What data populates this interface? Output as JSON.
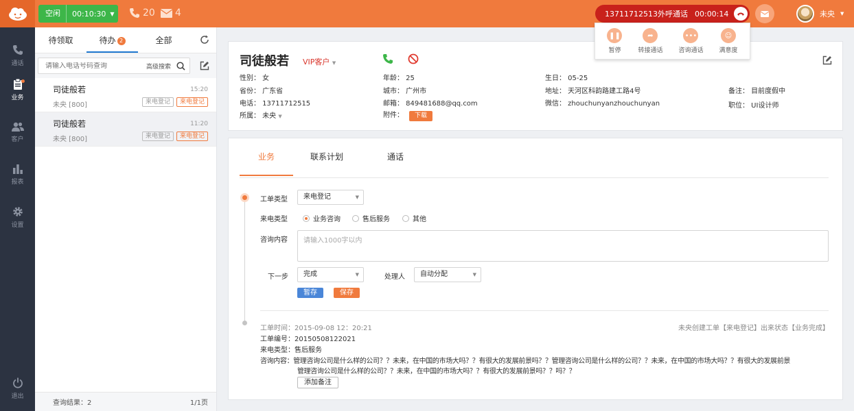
{
  "topbar": {
    "status_label": "空闲",
    "status_timer": "00:10:30",
    "missed_calls": "20",
    "messages": "4",
    "call_number_label": "13711712513外呼通话",
    "call_time": "00:00:14",
    "user_name": "未央",
    "accent_color": "#f07a3d"
  },
  "call_actions": [
    {
      "label": "暂停",
      "icon": "pause-icon"
    },
    {
      "label": "转接通话",
      "icon": "forward-icon"
    },
    {
      "label": "咨询通话",
      "icon": "chat-icon"
    },
    {
      "label": "满意度",
      "icon": "smile-icon"
    }
  ],
  "nav": [
    {
      "label": "通话",
      "icon": "phone-icon"
    },
    {
      "label": "业务",
      "icon": "clipboard-icon"
    },
    {
      "label": "客户",
      "icon": "users-icon"
    },
    {
      "label": "报表",
      "icon": "bar-chart-icon"
    },
    {
      "label": "设置",
      "icon": "gear-icon"
    },
    {
      "label": "退出",
      "icon": "power-icon"
    }
  ],
  "list": {
    "tabs": [
      "待领取",
      "待办",
      "全部"
    ],
    "todo_count": "2",
    "search_placeholder": "请输入电话号码查询",
    "advanced_search": "高级搜索",
    "items": [
      {
        "name": "司徒般若",
        "time": "15:20",
        "sub": "未央 [800]",
        "tag1": "来电登记",
        "tag2": "来电登记"
      },
      {
        "name": "司徒般若",
        "time": "11:20",
        "sub": "未央 [800]",
        "tag1": "来电登记",
        "tag2": "来电登记"
      }
    ],
    "result_label": "查询结果：2",
    "pager": "1/1页"
  },
  "customer": {
    "name": "司徒般若",
    "level": "VIP客户",
    "fields": {
      "gender": "性别：  女",
      "age": "年龄：  25",
      "birthday": "生日：  05-25",
      "province": "省份：  广东省",
      "city": "城市：  广州市",
      "address": "地址：  天河区科韵路建工路4号",
      "remark": "备注：  目前度假中",
      "phone": "电话：  13711712515",
      "email": "邮箱：  849481688@qq.com",
      "wechat": "微信：  zhouchunyanzhouchunyan",
      "position": "职位：  UI设计师",
      "owner": "所属：  未央",
      "attachment": "附件："
    },
    "download": "下载"
  },
  "work": {
    "tabs": [
      "业务",
      "联系计划",
      "通话"
    ],
    "form": {
      "order_type_label": "工单类型",
      "order_type_value": "来电登记",
      "call_type_label": "来电类型",
      "call_types": [
        "业务咨询",
        "售后服务",
        "其他"
      ],
      "content_label": "咨询内容",
      "content_placeholder": "请输入1000字以内",
      "next_label": "下一步",
      "next_value": "完成",
      "handler_label": "处理人",
      "handler_value": "自动分配",
      "temp_save": "暂存",
      "save": "保存"
    },
    "record": {
      "time": "工单时间：2015-09-08  12：20:21",
      "status": "未央创建工单【来电登记】出来状态【业务完成】",
      "number": "工单编号：20150508122021",
      "type": "来电类型：售后服务",
      "content1": "咨询内容：管理咨询公司是什么样的公司？？未来，在中国的市场大吗？？有很大的发展前景吗？？管理咨询公司是什么样的公司？？未来，在中国的市场大吗？？有很大的发展前景",
      "content2": "管理咨询公司是什么样的公司？？未来，在中国的市场大吗？？有很大的发展前景吗？？吗？？",
      "add_note": "添加备注"
    }
  }
}
